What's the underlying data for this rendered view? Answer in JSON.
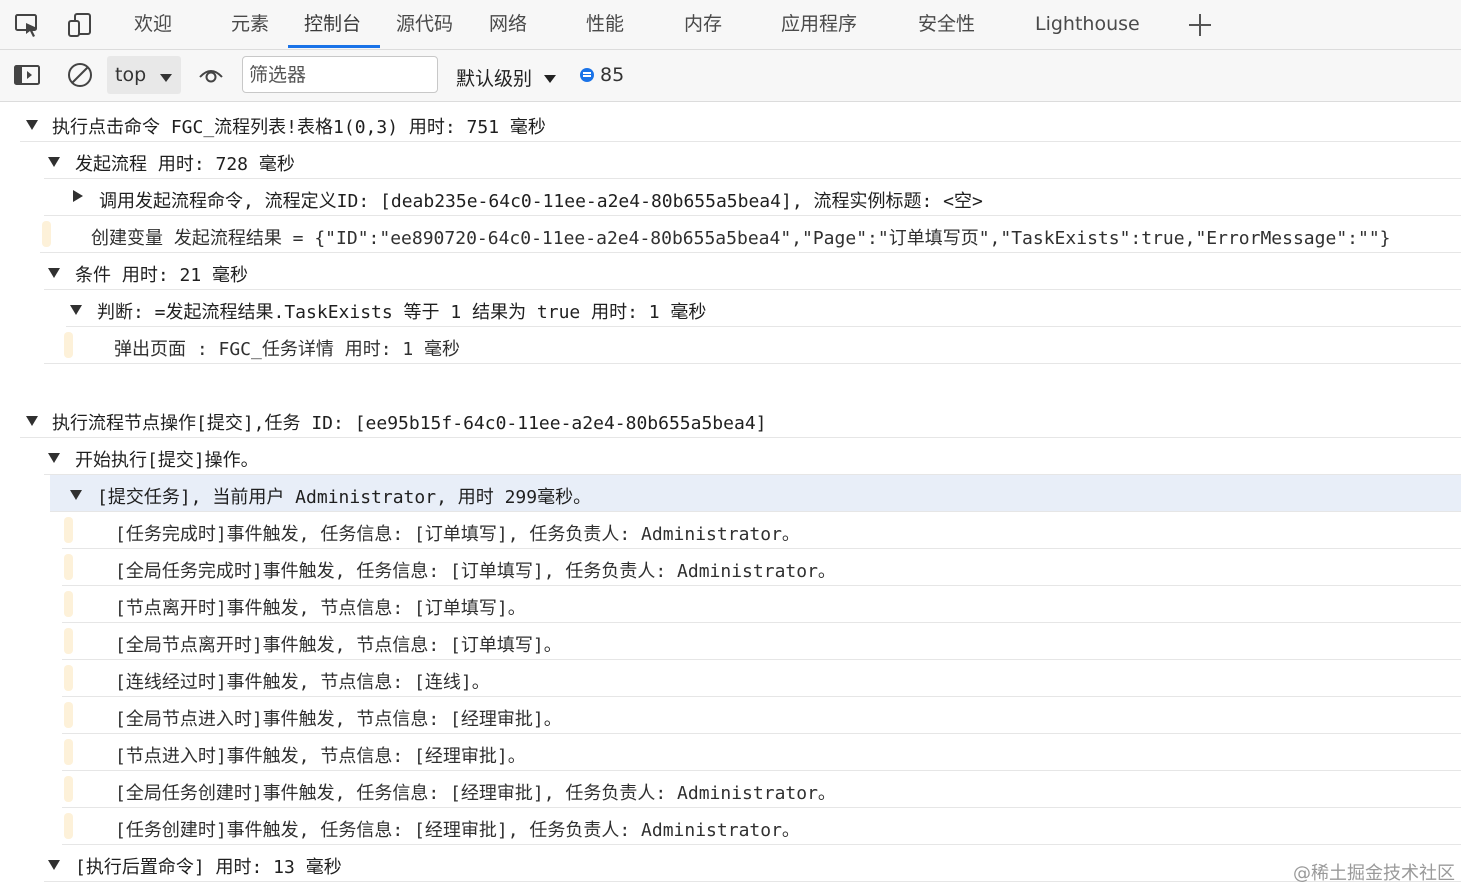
{
  "tabs": [
    {
      "label": "欢迎"
    },
    {
      "label": "元素"
    },
    {
      "label": "控制台"
    },
    {
      "label": "源代码"
    },
    {
      "label": "网络"
    },
    {
      "label": "性能"
    },
    {
      "label": "内存"
    },
    {
      "label": "应用程序"
    },
    {
      "label": "安全性"
    },
    {
      "label": "Lighthouse"
    }
  ],
  "active_tab": "控制台",
  "toolbar": {
    "context": "top",
    "filter_placeholder": "筛选器",
    "levels": "默认级别",
    "message_count": "85"
  },
  "console": {
    "rows": [
      {
        "kind": "group",
        "expanded": true,
        "text": "执行点击命令 FGC_流程列表!表格1(0,3) 用时: 751 毫秒"
      },
      {
        "kind": "group",
        "expanded": true,
        "text": "发起流程 用时: 728 毫秒"
      },
      {
        "kind": "group",
        "expanded": false,
        "text": "调用发起流程命令, 流程定义ID: [deab235e-64c0-11ee-a2e4-80b655a5bea4], 流程实例标题: <空>"
      },
      {
        "kind": "log",
        "text": "创建变量 发起流程结果 = {\"ID\":\"ee890720-64c0-11ee-a2e4-80b655a5bea4\",\"Page\":\"订单填写页\",\"TaskExists\":true,\"ErrorMessage\":\"\"}"
      },
      {
        "kind": "group",
        "expanded": true,
        "text": "条件 用时: 21 毫秒"
      },
      {
        "kind": "group",
        "expanded": true,
        "text": "判断: =发起流程结果.TaskExists 等于 1 结果为 true 用时: 1 毫秒"
      },
      {
        "kind": "log",
        "text": "弹出页面 : FGC_任务详情 用时: 1 毫秒"
      },
      {
        "kind": "group",
        "expanded": true,
        "text": "执行流程节点操作[提交],任务 ID: [ee95b15f-64c0-11ee-a2e4-80b655a5bea4]"
      },
      {
        "kind": "group",
        "expanded": true,
        "text": "开始执行[提交]操作。"
      },
      {
        "kind": "group",
        "expanded": true,
        "text": "[提交任务], 当前用户 Administrator, 用时 299毫秒。"
      },
      {
        "kind": "log",
        "text": "[任务完成时]事件触发, 任务信息: [订单填写], 任务负责人: Administrator。"
      },
      {
        "kind": "log",
        "text": "[全局任务完成时]事件触发, 任务信息: [订单填写], 任务负责人: Administrator。"
      },
      {
        "kind": "log",
        "text": "[节点离开时]事件触发, 节点信息: [订单填写]。"
      },
      {
        "kind": "log",
        "text": "[全局节点离开时]事件触发, 节点信息: [订单填写]。"
      },
      {
        "kind": "log",
        "text": "[连线经过时]事件触发, 节点信息: [连线]。"
      },
      {
        "kind": "log",
        "text": "[全局节点进入时]事件触发, 节点信息: [经理审批]。"
      },
      {
        "kind": "log",
        "text": "[节点进入时]事件触发, 节点信息: [经理审批]。"
      },
      {
        "kind": "log",
        "text": "[全局任务创建时]事件触发, 任务信息: [经理审批], 任务负责人: Administrator。"
      },
      {
        "kind": "log",
        "text": "[任务创建时]事件触发, 任务信息: [经理审批], 任务负责人: Administrator。"
      },
      {
        "kind": "group",
        "expanded": true,
        "text": "[执行后置命令] 用时: 13 毫秒"
      }
    ]
  },
  "watermark": "@稀土掘金技术社区",
  "colors": {
    "accent": "#1a73e8",
    "log_bar": "#fdf1d9",
    "highlight_row": "#e8eef8"
  }
}
